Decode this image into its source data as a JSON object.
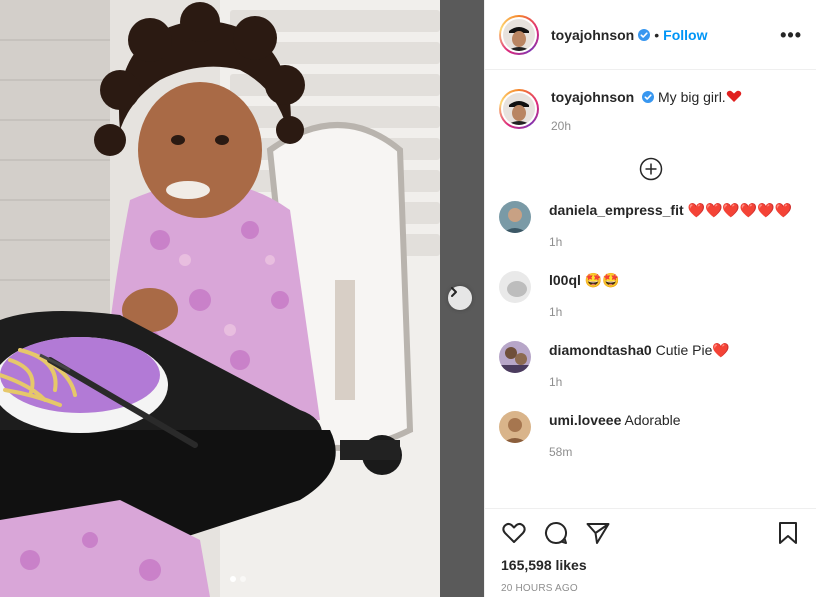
{
  "post": {
    "author": "toyajohnson",
    "follow_label": "Follow",
    "separator": "•",
    "more_label": "•••",
    "caption": "My big girl.",
    "caption_time": "20h",
    "likes": "165,598 likes",
    "posted_ago": "20 HOURS AGO",
    "carousel": {
      "count": 2,
      "active_index": 0
    }
  },
  "comments": [
    {
      "user": "daniela_empress_fit",
      "text": "❤️❤️❤️❤️❤️❤️",
      "time": "1h"
    },
    {
      "user": "l00ql",
      "text": "🤩🤩",
      "time": "1h"
    },
    {
      "user": "diamondtasha0",
      "text": "Cutie Pie❤️",
      "time": "1h"
    },
    {
      "user": "umi.loveee",
      "text": "Adorable",
      "time": "58m"
    }
  ],
  "icons": {
    "verified": "verified-badge-icon",
    "load_more": "plus-circle-icon",
    "like": "heart-outline-icon",
    "comment": "comment-bubble-icon",
    "share": "paper-plane-icon",
    "save": "bookmark-icon",
    "next": "chevron-right-icon"
  },
  "colors": {
    "accent": "#0095f6",
    "heart": "#e0201f",
    "muted": "#8e8e8e"
  }
}
